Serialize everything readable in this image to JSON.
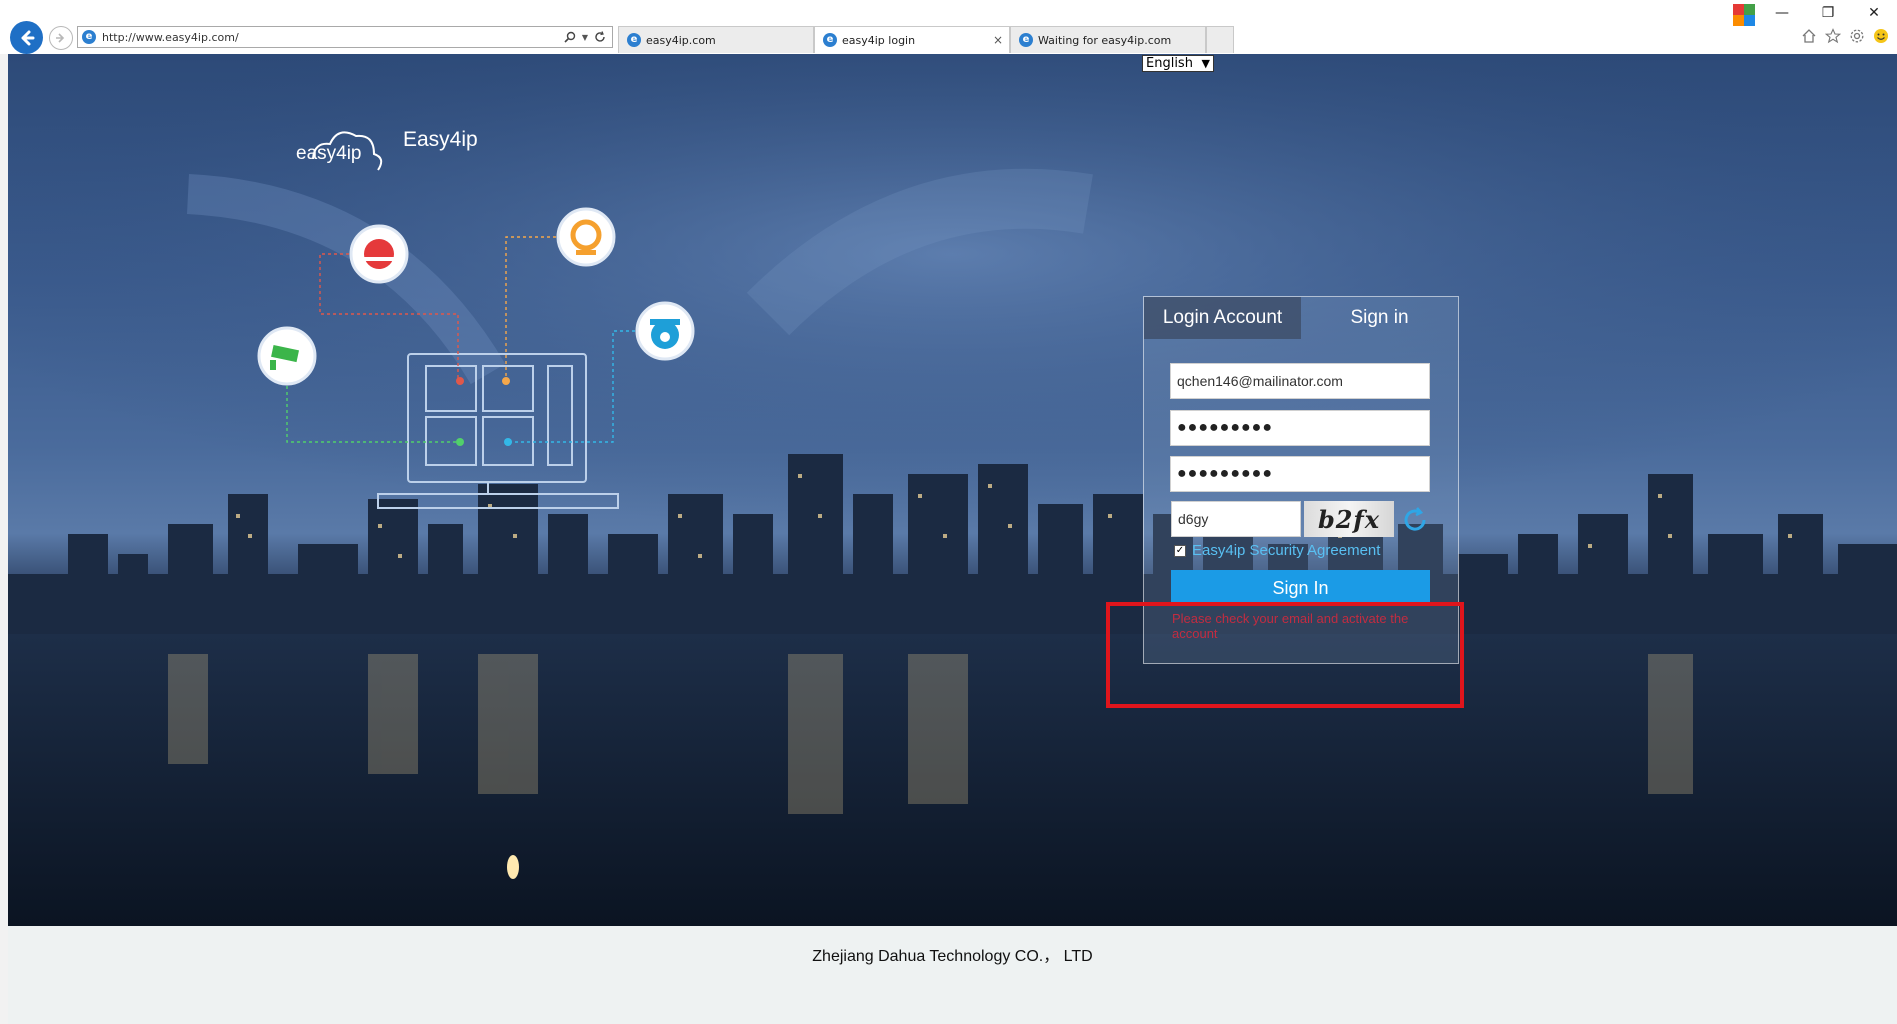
{
  "browser": {
    "url": "http://www.easy4ip.com/",
    "tabs": [
      {
        "title": "easy4ip.com",
        "active": false
      },
      {
        "title": "easy4ip login",
        "active": true
      },
      {
        "title": "Waiting for easy4ip.com",
        "active": false
      }
    ],
    "tab_close_glyph": "×",
    "window_controls": {
      "minimize": "—",
      "restore": "❐",
      "close": "✕"
    },
    "language_select": {
      "value": "English",
      "caret": "▼"
    }
  },
  "brand": {
    "logo_text": "easy4ip",
    "name": "Easy4ip"
  },
  "login": {
    "tabs": [
      {
        "label": "Login Account",
        "active": true
      },
      {
        "label": "Sign in",
        "active": false
      }
    ],
    "email_value": "qchen146@mailinator.com",
    "password_value": "●●●●●●●●●",
    "confirm_password_value": "●●●●●●●●●",
    "captcha_value": "d6gy",
    "captcha_image_text": "b2fx",
    "agreement_checked": "✓",
    "agreement_label": "Easy4ip Security Agreement",
    "sign_in_button": "Sign In",
    "error_message": "Please check your email and activate the account"
  },
  "footer": {
    "company": "Zhejiang Dahua Technology CO.， LTD"
  },
  "colors": {
    "accent": "#1b9be6",
    "error": "#e0151c",
    "link": "#59c0f2"
  },
  "icons": [
    "back-arrow-icon",
    "forward-arrow-icon",
    "search-icon",
    "refresh-icon",
    "home-icon",
    "star-icon",
    "gear-icon",
    "smiley-icon",
    "ie-favicon",
    "camera-icon",
    "dome-camera-icon",
    "ptz-camera-icon",
    "bullet-camera-icon",
    "cloud-icon",
    "monitor-icon"
  ]
}
